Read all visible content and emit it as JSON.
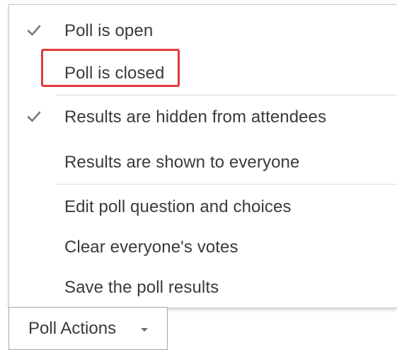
{
  "menu": {
    "items": [
      {
        "label": "Poll is open",
        "checked": true,
        "icon": "check-icon"
      },
      {
        "label": "Poll is closed",
        "checked": false,
        "highlighted": true
      },
      {
        "label": "Results are hidden from attendees",
        "checked": true,
        "icon": "check-icon"
      },
      {
        "label": "Results are shown to everyone",
        "checked": false
      },
      {
        "label": "Edit poll question and choices",
        "checked": false
      },
      {
        "label": "Clear everyone's votes",
        "checked": false
      },
      {
        "label": "Save the poll results",
        "checked": false
      }
    ]
  },
  "footer": {
    "button_label": "Poll Actions",
    "icon": "chevron-down-icon"
  },
  "colors": {
    "highlight": "#e0393e",
    "text": "#3a3a3a",
    "check": "#7a7a7a"
  }
}
